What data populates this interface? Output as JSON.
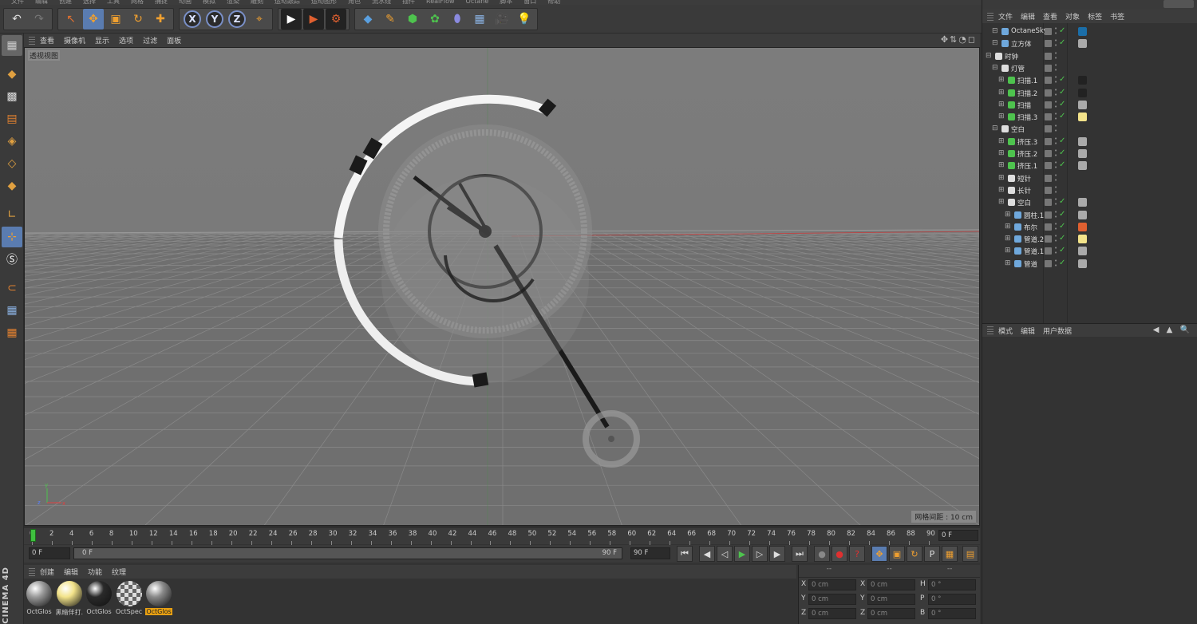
{
  "menubar": [
    "文件",
    "编辑",
    "创建",
    "选择",
    "工具",
    "网格",
    "捕捉",
    "动画",
    "模拟",
    "渲染",
    "雕刻",
    "运动跟踪",
    "运动图形",
    "角色",
    "流水线",
    "插件",
    "RealFlow",
    "Octane",
    "脚本",
    "窗口",
    "帮助"
  ],
  "toolbar": {
    "undo_icon": "↶",
    "redo_icon": "↷",
    "select_icon": "↖",
    "move_icon": "✥",
    "scale_icon": "▣",
    "rotate_icon": "↻",
    "add_icon": "✚",
    "axis_x": "X",
    "axis_y": "Y",
    "axis_z": "Z",
    "coord_icon": "⌖",
    "render_view": "▶",
    "render_active": "▶",
    "render_settings": "⚙",
    "cube_icon": "◆",
    "pen_icon": "✎",
    "nurbs_icon": "⬢",
    "array_icon": "✿",
    "deformer_icon": "⬮",
    "floor_icon": "▦",
    "camera_icon": "🎥",
    "light_icon": "💡"
  },
  "viewport": {
    "menu": [
      "查看",
      "摄像机",
      "显示",
      "选项",
      "过滤",
      "面板"
    ],
    "nav_icons": "✥⇅◔◻",
    "label": "透视视图",
    "grid_spacing": "网格间距 : 10 cm"
  },
  "timeline": {
    "ticks": [
      "0",
      "2",
      "4",
      "6",
      "8",
      "10",
      "12",
      "14",
      "16",
      "18",
      "20",
      "22",
      "24",
      "26",
      "28",
      "30",
      "32",
      "34",
      "36",
      "38",
      "40",
      "42",
      "44",
      "46",
      "48",
      "50",
      "52",
      "54",
      "56",
      "58",
      "60",
      "62",
      "64",
      "66",
      "68",
      "70",
      "72",
      "74",
      "76",
      "78",
      "80",
      "82",
      "84",
      "86",
      "88",
      "90"
    ],
    "current_frame_box": "0 F",
    "playhead_frame": 0
  },
  "transport": {
    "start_field": "0 F",
    "range_start": "0 F",
    "range_end": "90 F",
    "end_field": "90 F",
    "btn_first": "⏮",
    "btn_prev_key": "◀",
    "btn_prev": "◁",
    "btn_play": "▶",
    "btn_next": "▷",
    "btn_next_key": "▶",
    "btn_last": "⏭",
    "btn_record": "●",
    "btn_auto": "●",
    "btn_key": "?",
    "btn_move": "✥",
    "btn_scale": "▣",
    "btn_rotate": "↻",
    "btn_param": "P",
    "btn_pla": "▦",
    "btn_film": "▤"
  },
  "materials": {
    "menu": [
      "创建",
      "编辑",
      "功能",
      "纹理"
    ],
    "items": [
      {
        "label": "OctGlos",
        "color": "#9a9a9a"
      },
      {
        "label": "黑暗伴打...",
        "color": "#f3e38a"
      },
      {
        "label": "OctGlos",
        "color": "#2a2a2a"
      },
      {
        "label": "OctSpec",
        "color": "#bbbbbb"
      },
      {
        "label": "OctGlos",
        "color": "#8a8a8a"
      }
    ]
  },
  "coords": {
    "headers": [
      "--",
      "--",
      "--"
    ],
    "rows": [
      {
        "a": "X",
        "av": "0 cm",
        "b": "X",
        "bv": "0 cm",
        "c": "H",
        "cv": "0 °"
      },
      {
        "a": "Y",
        "av": "0 cm",
        "b": "Y",
        "bv": "0 cm",
        "c": "P",
        "cv": "0 °"
      },
      {
        "a": "Z",
        "av": "0 cm",
        "b": "Z",
        "bv": "0 cm",
        "c": "B",
        "cv": "0 °"
      }
    ]
  },
  "object_manager": {
    "menu": [
      "文件",
      "编辑",
      "查看",
      "对象",
      "标签",
      "书签"
    ],
    "rows": [
      {
        "name": "OctaneSky",
        "depth": 1,
        "icon_color": "#6fa8dc",
        "tag": "#1b6ea8"
      },
      {
        "name": "立方体",
        "depth": 1,
        "icon_color": "#6fa8dc",
        "tag": "#aaaaaa"
      },
      {
        "name": "时钟",
        "depth": 0,
        "icon_color": "#dddddd",
        "tag": ""
      },
      {
        "name": "灯管",
        "depth": 1,
        "icon_color": "#dddddd",
        "tag": ""
      },
      {
        "name": "扫描.1",
        "depth": 2,
        "icon_color": "#4ec34e",
        "tag": "#222222"
      },
      {
        "name": "扫描.2",
        "depth": 2,
        "icon_color": "#4ec34e",
        "tag": "#222222"
      },
      {
        "name": "扫描",
        "depth": 2,
        "icon_color": "#4ec34e",
        "tag": "#aaaaaa"
      },
      {
        "name": "扫描.3",
        "depth": 2,
        "icon_color": "#4ec34e",
        "tag": "#f3e38a"
      },
      {
        "name": "空白",
        "depth": 1,
        "icon_color": "#dddddd",
        "tag": ""
      },
      {
        "name": "挤压.3",
        "depth": 2,
        "icon_color": "#4ec34e",
        "tag": "#aaaaaa"
      },
      {
        "name": "挤压.2",
        "depth": 2,
        "icon_color": "#4ec34e",
        "tag": "#aaaaaa"
      },
      {
        "name": "挤压.1",
        "depth": 2,
        "icon_color": "#4ec34e",
        "tag": "#aaaaaa"
      },
      {
        "name": "短针",
        "depth": 2,
        "icon_color": "#dddddd",
        "tag": ""
      },
      {
        "name": "长针",
        "depth": 2,
        "icon_color": "#dddddd",
        "tag": ""
      },
      {
        "name": "空白",
        "depth": 2,
        "icon_color": "#dddddd",
        "tag": "#aaaaaa"
      },
      {
        "name": "圆柱.1",
        "depth": 3,
        "icon_color": "#6fa8dc",
        "tag": "#aaaaaa"
      },
      {
        "name": "布尔",
        "depth": 3,
        "icon_color": "#6fa8dc",
        "tag": "#e06030"
      },
      {
        "name": "管道.2",
        "depth": 3,
        "icon_color": "#6fa8dc",
        "tag": "#f3e38a"
      },
      {
        "name": "管道.1",
        "depth": 3,
        "icon_color": "#6fa8dc",
        "tag": "#aaaaaa"
      },
      {
        "name": "管道",
        "depth": 3,
        "icon_color": "#6fa8dc",
        "tag": "#aaaaaa"
      }
    ]
  },
  "attribute_manager": {
    "menu": [
      "模式",
      "编辑",
      "用户数据"
    ],
    "nav": "◀ ▲ 🔍"
  },
  "branding": {
    "logo_text": "CINEMA 4D"
  }
}
